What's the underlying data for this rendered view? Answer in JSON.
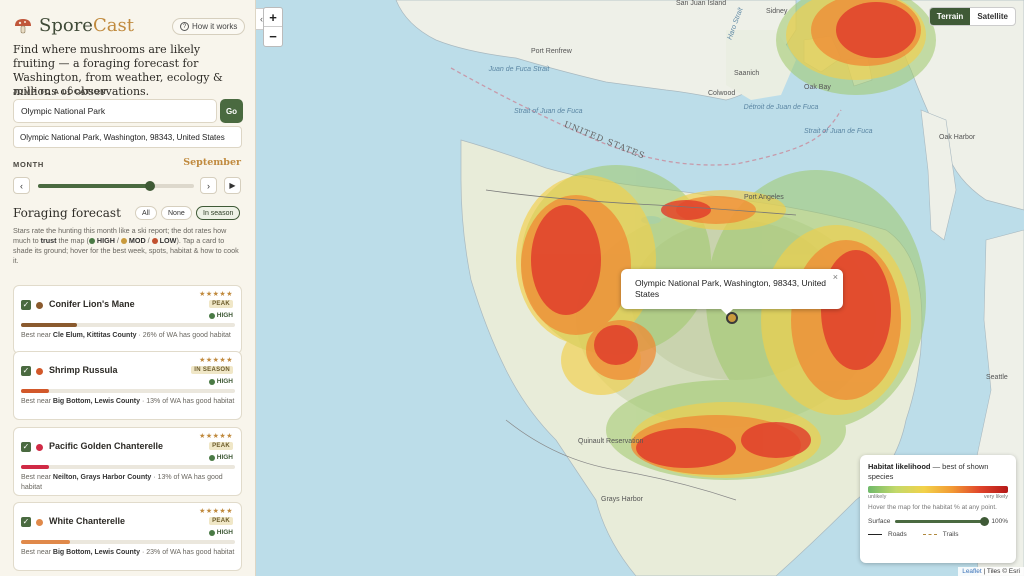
{
  "app": {
    "name_part1": "Spore",
    "name_part2": "Cast",
    "how_label": "How it works"
  },
  "intro": "Find where mushrooms are likely fruiting — a foraging forecast for Washington, from weather, ecology & millions of observations.",
  "jump": {
    "label": "JUMP TO A LOCATION",
    "query": "Olympic National Park",
    "go_label": "Go",
    "result": "Olympic National Park, Washington, 98343, United States"
  },
  "month": {
    "label": "MONTH",
    "value": "September",
    "prev": "‹",
    "next": "›",
    "play": "▶",
    "position": 0.72
  },
  "forecast": {
    "title": "Foraging forecast",
    "filters": [
      {
        "label": "All",
        "active": false
      },
      {
        "label": "None",
        "active": false
      },
      {
        "label": "In season",
        "active": true
      }
    ],
    "help_1": "Stars rate the hunting this month like a ski report; the dot rates how much to ",
    "help_trust": "trust",
    "help_2": " the map (",
    "lv_high": "HIGH",
    "lv_mod": "MOD",
    "lv_low": "LOW",
    "help_3": "). Tap a card to shade its ground; hover for the best week, spots, habitat & how to cook it.",
    "level_colors": {
      "high": "#4a7a45",
      "mod": "#c99a3c",
      "low": "#c1502e"
    }
  },
  "cards": [
    {
      "name": "Conifer Lion's Mane",
      "dot_color": "#8a5a2e",
      "stars": "★★★★★",
      "badge": "PEAK",
      "confidence": "HIGH",
      "fill": 0.26,
      "bar_color": "#8a5a2e",
      "best_prefix": "Best near ",
      "best_place": "Cle Elum, Kittitas County",
      "best_suffix": " · 26% of WA has good habitat"
    },
    {
      "name": "Shrimp Russula",
      "dot_color": "#d2582a",
      "stars": "★★★★★",
      "badge": "IN SEASON",
      "confidence": "HIGH",
      "fill": 0.13,
      "bar_color": "#d2582a",
      "best_prefix": "Best near ",
      "best_place": "Big Bottom, Lewis County",
      "best_suffix": " · 13% of WA has good habitat"
    },
    {
      "name": "Pacific Golden Chanterelle",
      "dot_color": "#d02a45",
      "stars": "★★★★★",
      "badge": "PEAK",
      "confidence": "HIGH",
      "fill": 0.13,
      "bar_color": "#d02a45",
      "best_prefix": "Best near ",
      "best_place": "Neilton, Grays Harbor County",
      "best_suffix": " · 13% of WA has good habitat"
    },
    {
      "name": "White Chanterelle",
      "dot_color": "#e0894a",
      "stars": "★★★★★",
      "badge": "PEAK",
      "confidence": "HIGH",
      "fill": 0.23,
      "bar_color": "#e0894a",
      "best_prefix": "Best near ",
      "best_place": "Big Bottom, Lewis County",
      "best_suffix": " · 23% of WA has good habitat"
    }
  ],
  "map": {
    "zoom_in": "+",
    "zoom_out": "−",
    "collapse": "‹",
    "layers": [
      {
        "label": "Terrain",
        "active": true
      },
      {
        "label": "Satellite",
        "active": false
      }
    ],
    "popup": "Olympic National Park, Washington, 98343, United States",
    "popup_close": "×",
    "labels": {
      "saanich": "Saanich",
      "sidney": "Sidney",
      "oak_bay": "Oak Bay",
      "port_renfrew": "Port Renfrew",
      "colwood": "Colwood",
      "port_angeles": "Port Angeles",
      "oak_harbor": "Oak Harbor",
      "seattle": "Seattle",
      "quinault": "Quinault Reservation",
      "greyes": "Grays Harbor",
      "juan1": "Juan de Fuca Strait",
      "juan2": "Strait of Juan de Fuca",
      "juan3": "Détroit de Juan de Fuca",
      "juan4": "Strait of Juan de Fuca",
      "united_states": "UNITED STATES",
      "haro": "Haro Strait",
      "victoria_top": "San Juan Island"
    },
    "legend": {
      "title_bold": "Habitat likelihood",
      "title_rest": " — best of shown species",
      "low": "unlikely",
      "high": "very likely",
      "hint": "Hover the map for the habitat % at any point.",
      "surface_label": "Surface",
      "surface_value": "100%",
      "roads": "Roads",
      "trails": "Trails"
    },
    "attribution": {
      "leaflet": "Leaflet",
      "rest": " | Tiles © Esri"
    }
  }
}
